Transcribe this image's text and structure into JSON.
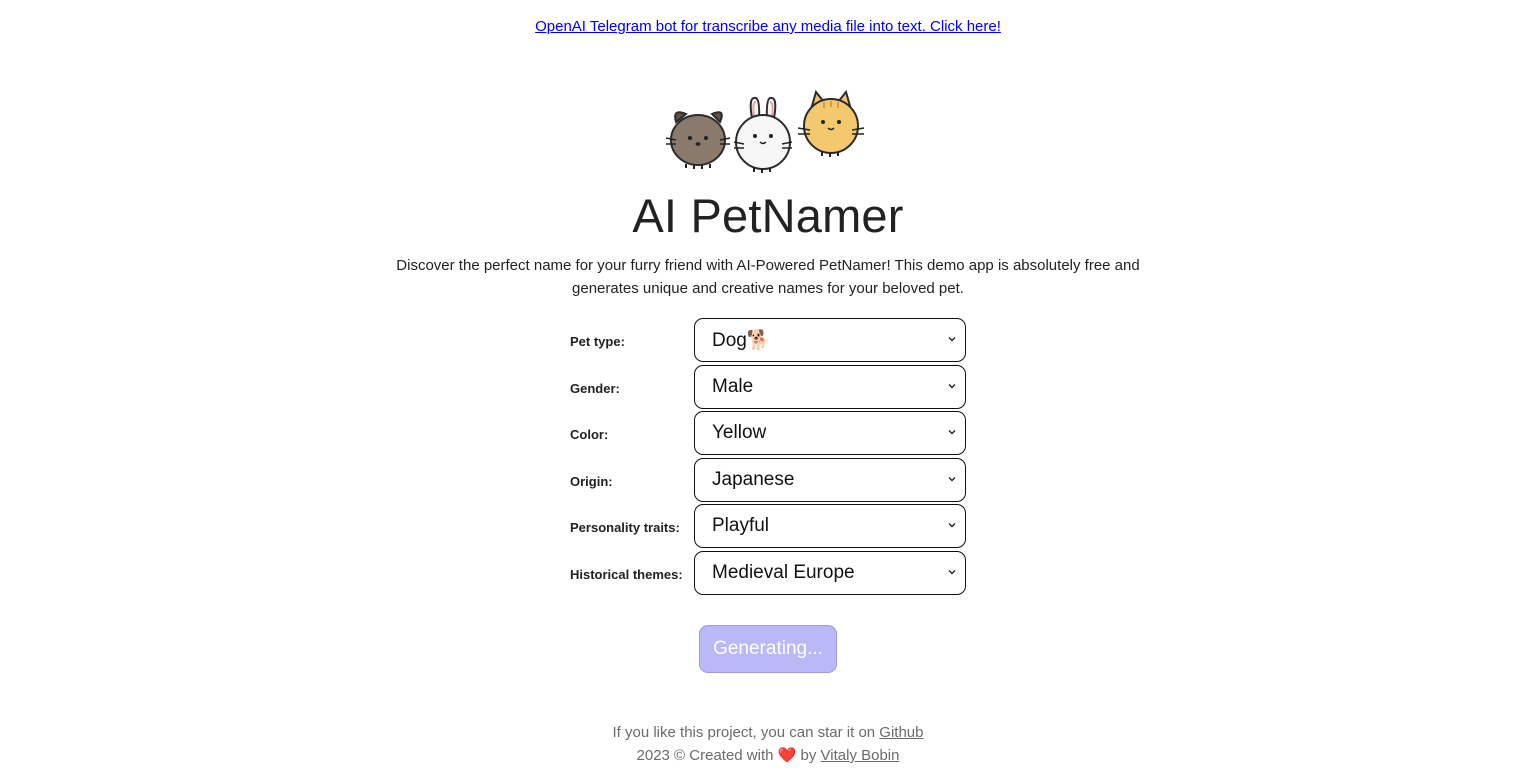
{
  "top_link": {
    "text": "OpenAI Telegram bot for transcribe any media file into text. Click here!"
  },
  "hero": {
    "title": "AI PetNamer",
    "description": "Discover the perfect name for your furry friend with AI-Powered PetNamer! This demo app is absolutely free and generates unique and creative names for your beloved pet."
  },
  "form": {
    "fields": [
      {
        "label": "Pet type:",
        "value": "Dog🐕"
      },
      {
        "label": "Gender:",
        "value": "Male"
      },
      {
        "label": "Color:",
        "value": "Yellow"
      },
      {
        "label": "Origin:",
        "value": "Japanese"
      },
      {
        "label": "Personality traits:",
        "value": "Playful"
      },
      {
        "label": "Historical themes:",
        "value": "Medieval Europe"
      }
    ],
    "submit_label": "Generating..."
  },
  "footer": {
    "line1_prefix": "If you like this project, you can star it on ",
    "github_link": "Github",
    "line2_prefix": "2023 © Created with ",
    "heart": "❤️",
    "line2_mid": " by ",
    "author_link": "Vitaly Bobin"
  },
  "colors": {
    "link": "#0000ee",
    "button_disabled_bg": "#b9b9f7",
    "footer_text": "#6b6b6b",
    "heart": "#e0282e"
  },
  "icons": {
    "mascots": [
      "dog-mascot-icon",
      "bunny-mascot-icon",
      "cat-mascot-icon"
    ],
    "select_arrow": "chevron-down-icon"
  }
}
